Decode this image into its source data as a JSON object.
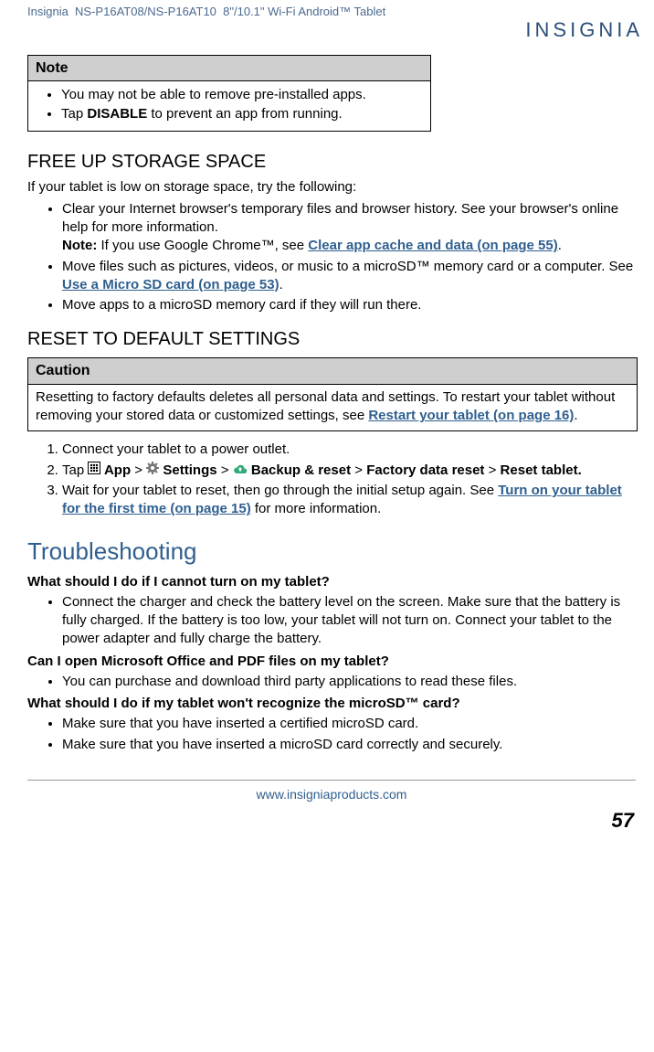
{
  "header": {
    "brand": "Insignia",
    "model": "NS-P16AT08/NS-P16AT10",
    "desc": "8\"/10.1\" Wi-Fi Android™ Tablet",
    "logo": "INSIGNIA"
  },
  "noteBox": {
    "title": "Note",
    "items": [
      {
        "pre": "You may not be able to remove pre-installed apps."
      },
      {
        "pre": "Tap ",
        "bold": "DISABLE",
        "post": " to prevent an app from running."
      }
    ]
  },
  "freeUp": {
    "heading": "FREE UP STORAGE SPACE",
    "intro": "If your tablet is low on storage space, try the following:",
    "b1a": "Clear your Internet browser's temporary files and browser history. See your browser's online help for more information.",
    "b1noteLabel": "Note:",
    "b1b": " If you use Google Chrome™, see ",
    "b1link": "Clear app cache and data (on page 55)",
    "b1c": ".",
    "b2a": "Move files such as pictures, videos, or music to a microSD™ memory card or a computer. See ",
    "b2link": "Use a Micro SD card (on page 53)",
    "b2b": ".",
    "b3": "Move apps to a microSD memory card if they will run there."
  },
  "reset": {
    "heading": "RESET TO DEFAULT SETTINGS",
    "cautionTitle": "Caution",
    "cautionA": "Resetting to factory defaults deletes all personal data and settings. To restart your tablet without removing your stored data or customized settings, see ",
    "cautionLink": "Restart your tablet (on page 16)",
    "cautionB": ".",
    "s1": "Connect your tablet to a power outlet.",
    "s2_tap": "Tap ",
    "s2_app": " App",
    "s2_gt1": " > ",
    "s2_settings": " Settings",
    "s2_gt2": " > ",
    "s2_backup": " Backup & reset",
    "s2_gt3": " > ",
    "s2_factory": "Factory data reset",
    "s2_gt4": " > ",
    "s2_resetTablet": "Reset tablet.",
    "s3a": "Wait for your tablet to reset, then go through the initial setup again. See ",
    "s3link": "Turn on your tablet for the first time (on page 15)",
    "s3b": " for more information."
  },
  "troubleshooting": {
    "heading": "Troubleshooting",
    "q1": "What should I do if I cannot turn on my tablet?",
    "a1": "Connect the charger and check the battery level on the screen. Make sure that the battery is fully charged. If the battery is too low, your tablet will not turn on. Connect your tablet to the power adapter and fully charge the battery.",
    "q2": "Can I open Microsoft Office and PDF files on my tablet?",
    "a2": "You can purchase and download third party applications to read these files.",
    "q3": "What should I do if my tablet won't recognize the microSD™ card?",
    "a3_1": "Make sure that you have inserted a certified microSD card.",
    "a3_2": "Make sure that you have inserted a microSD card correctly and securely."
  },
  "footer": {
    "url": "www.insigniaproducts.com",
    "page": "57"
  }
}
